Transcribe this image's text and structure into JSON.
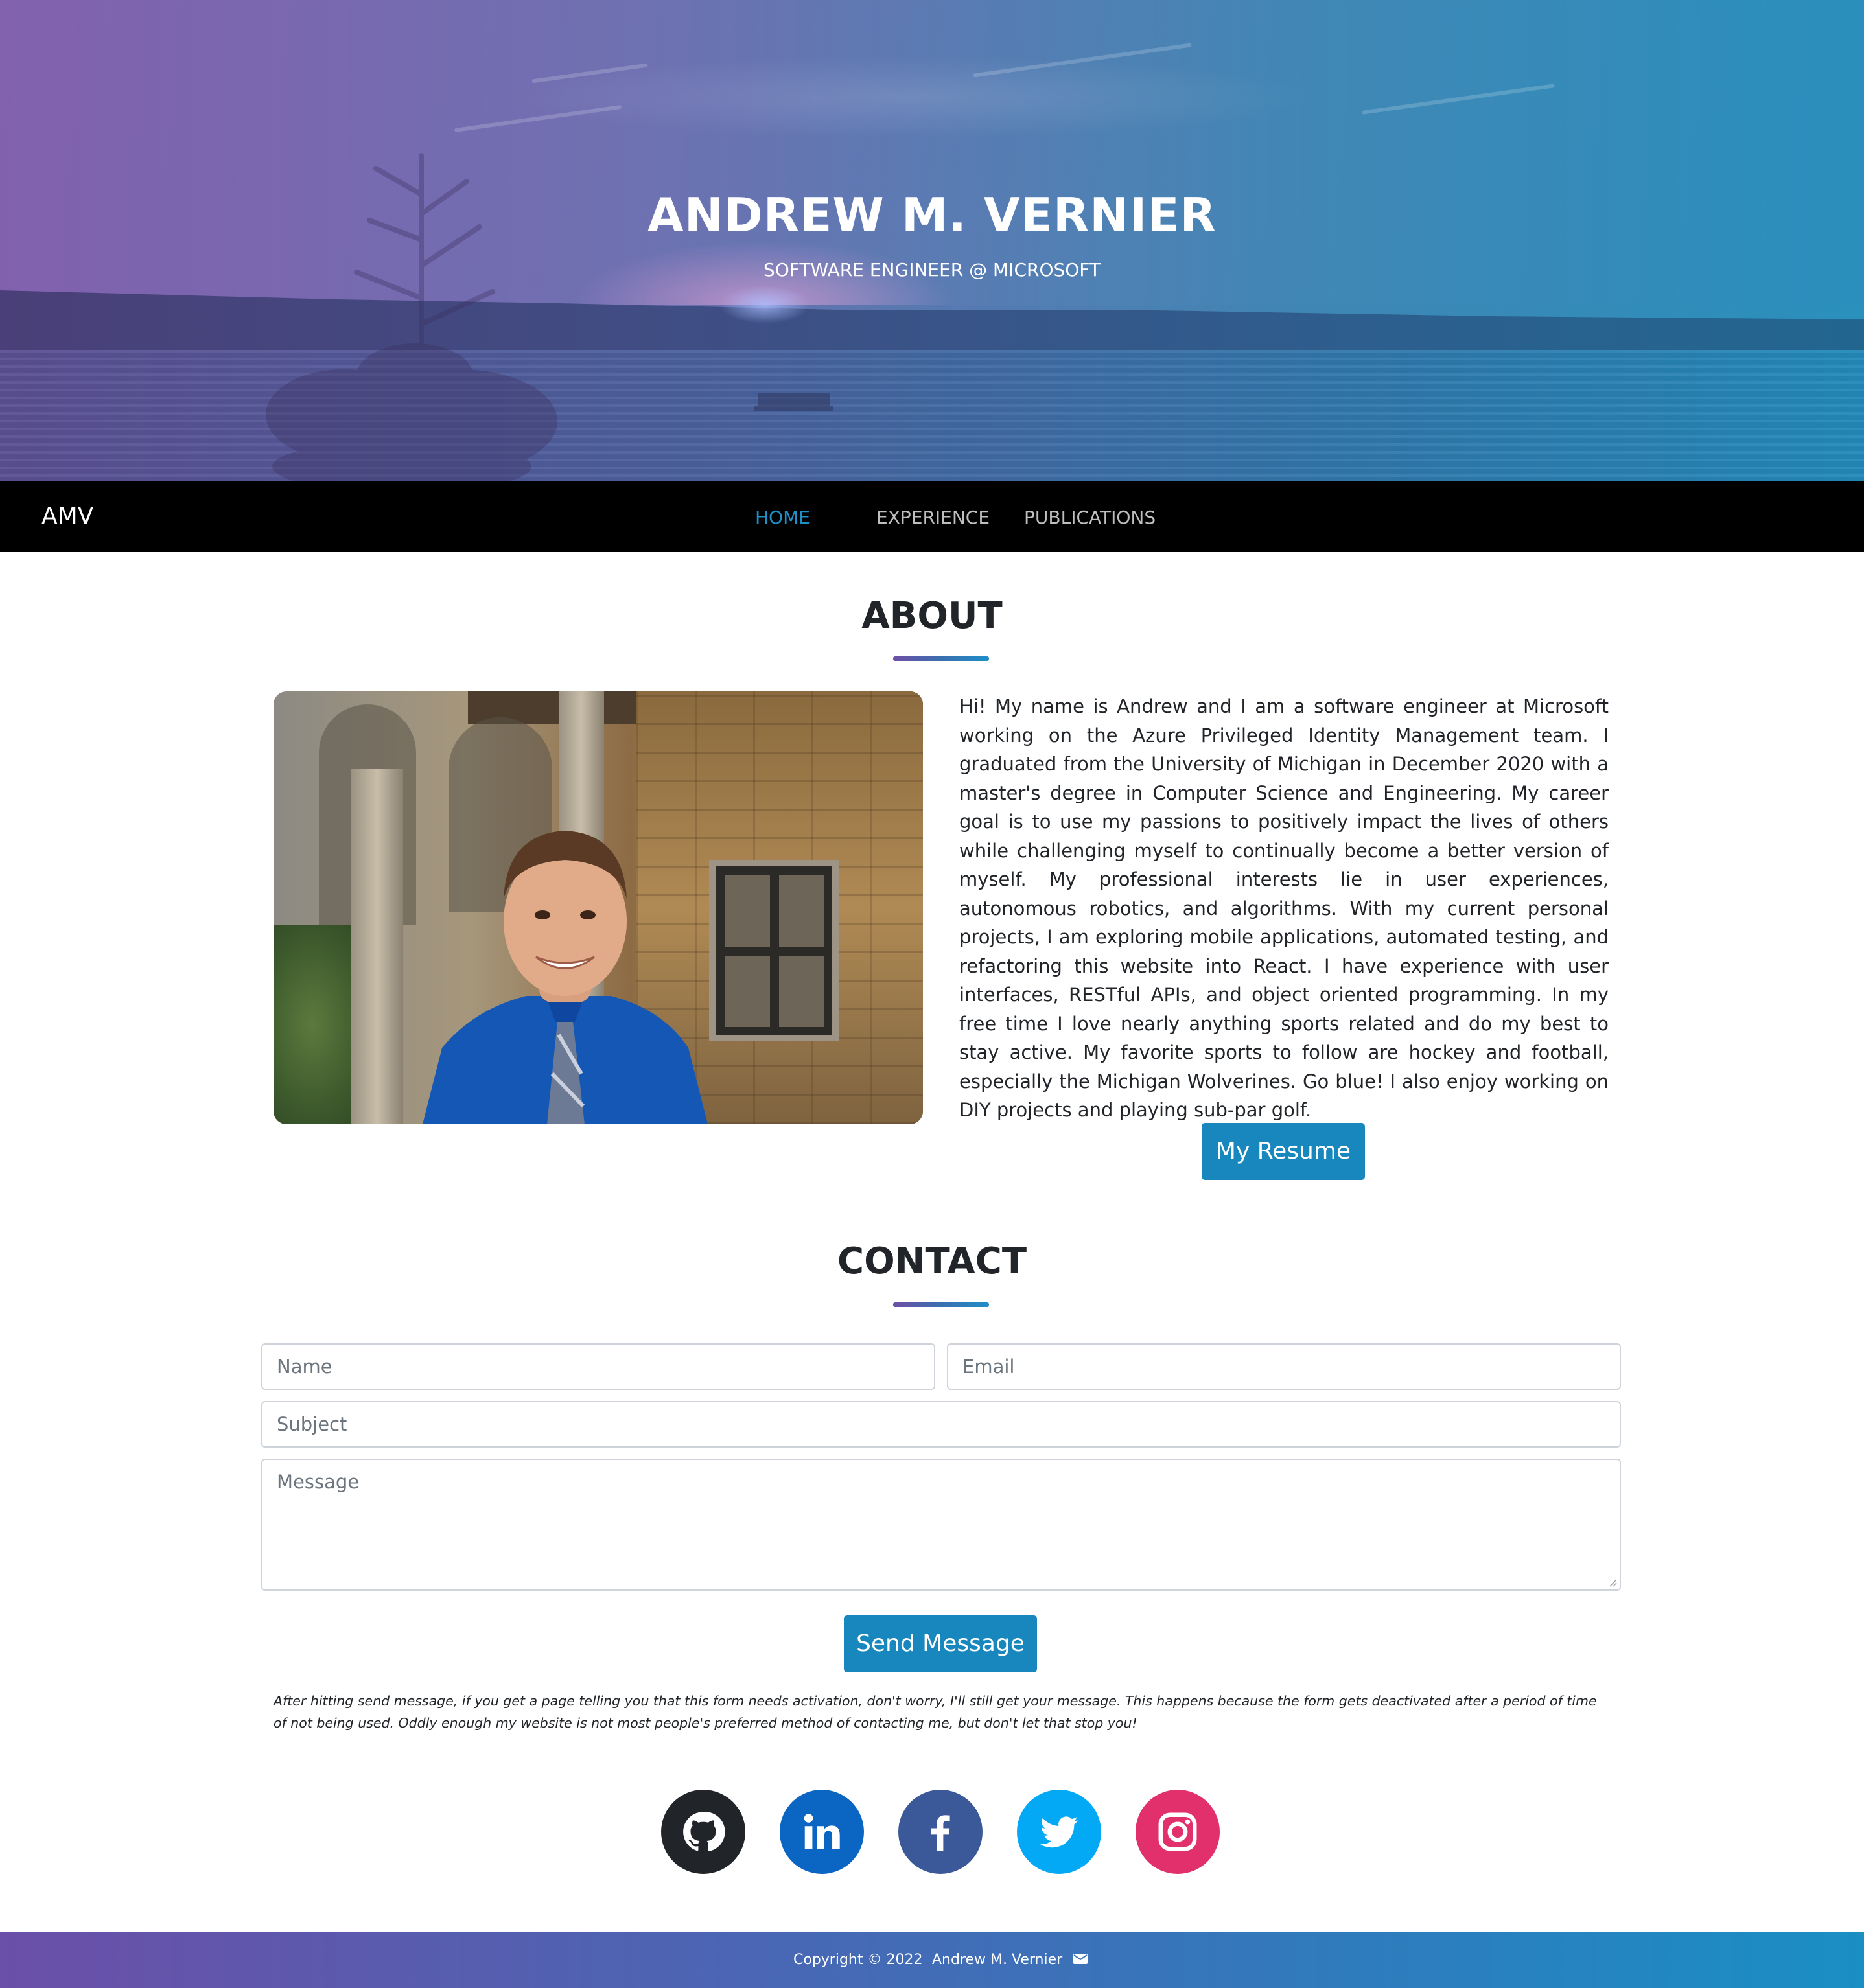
{
  "hero": {
    "title": "ANDREW M. VERNIER",
    "subtitle": "SOFTWARE ENGINEER @ MICROSOFT"
  },
  "navbar": {
    "brand": "AMV",
    "links": [
      {
        "label": "HOME",
        "active": true
      },
      {
        "label": "EXPERIENCE",
        "active": false
      },
      {
        "label": "PUBLICATIONS",
        "active": false
      }
    ]
  },
  "about": {
    "heading": "ABOUT",
    "bio": "Hi! My name is Andrew and I am a software engineer at Microsoft working on the Azure Privileged Identity Management team. I graduated from the University of Michigan in December 2020 with a master's degree in Computer Science and Engineering. My career goal is to use my passions to positively impact the lives of others while challenging myself to continually become a better version of myself. My professional interests lie in user experiences, autonomous robotics, and algorithms. With my current personal projects, I am exploring mobile applications, automated testing, and refactoring this website into React. I have experience with user interfaces, RESTful APIs, and object oriented programming. In my free time I love nearly anything sports related and do my best to stay active. My favorite sports to follow are hockey and football, especially the Michigan Wolverines. Go blue! I also enjoy working on DIY projects and playing sub-par golf.",
    "resume_button": "My Resume"
  },
  "contact": {
    "heading": "CONTACT",
    "name_placeholder": "Name",
    "email_placeholder": "Email",
    "subject_placeholder": "Subject",
    "message_placeholder": "Message",
    "send_button": "Send Message",
    "note": "After hitting send message, if you get a page telling you that this form needs activation, don't worry, I'll still get your message. This happens because the form gets deactivated after a period of time of not being used. Oddly enough my website is not most people's preferred method of contacting me, but don't let that stop you!"
  },
  "social": [
    {
      "icon": "github-icon",
      "color": "#212529"
    },
    {
      "icon": "linkedin-icon",
      "color": "#0a66c2"
    },
    {
      "icon": "facebook-icon",
      "color": "#3b5998"
    },
    {
      "icon": "twitter-icon",
      "color": "#03a9f4"
    },
    {
      "icon": "instagram-icon",
      "color": "#e1306c"
    }
  ],
  "footer": {
    "copyright": "Copyright © 2022",
    "name": "Andrew M. Vernier",
    "mail_icon": "envelope-icon"
  },
  "colors": {
    "accent": "#1787bd",
    "nav_active": "#1e8fc7",
    "navbar_bg": "#000000"
  }
}
